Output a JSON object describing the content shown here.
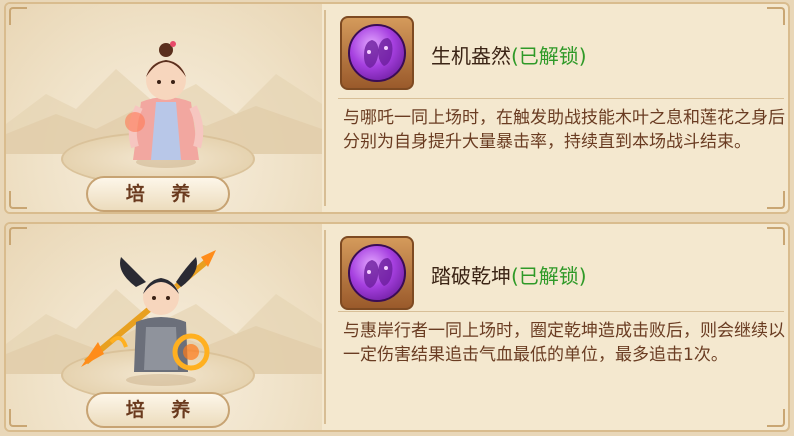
{
  "cards": [
    {
      "train_label": "培 养",
      "skill_name": "生机盎然",
      "status": "(已解锁)",
      "description": "与哪吒一同上场时，在触发助战技能木叶之息和莲花之身后分别为自身提升大量暴击率，持续直到本场战斗结束。"
    },
    {
      "train_label": "培 养",
      "skill_name": "踏破乾坤",
      "status": "(已解锁)",
      "description": "与惠岸行者一同上场时，圈定乾坤造成击败后，则会继续以一定伤害结果追击气血最低的单位，最多追击1次。"
    }
  ],
  "colors": {
    "unlocked": "#2f9a28",
    "text": "#6a3c22",
    "panel": "#f4e8cf"
  },
  "icons": [
    "purple-skill-orb-icon",
    "purple-skill-orb-icon"
  ]
}
